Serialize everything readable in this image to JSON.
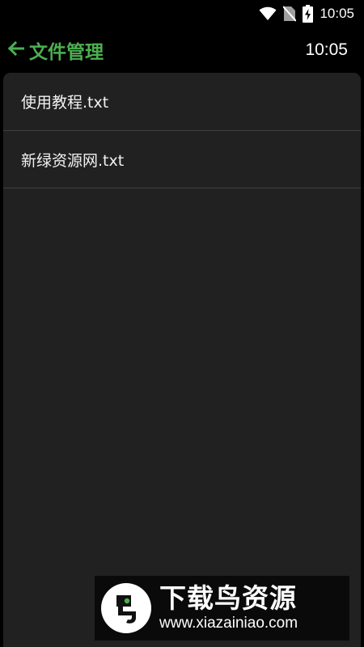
{
  "status_bar": {
    "time": "10:05",
    "icons": [
      "wifi-icon",
      "no-sim-icon",
      "battery-charging-icon"
    ]
  },
  "header": {
    "back_icon": "arrow-left-icon",
    "title": "文件管理",
    "time": "10:05"
  },
  "files": [
    {
      "name": "使用教程.txt"
    },
    {
      "name": "新绿资源网.txt"
    }
  ],
  "watermark": {
    "brand": "下载鸟资源",
    "url": "www.xiazainiao.com"
  },
  "colors": {
    "accent": "#4caf50",
    "background": "#000000",
    "panel": "#212121",
    "divider": "#3f3f3f",
    "text": "#f2f2f2"
  }
}
